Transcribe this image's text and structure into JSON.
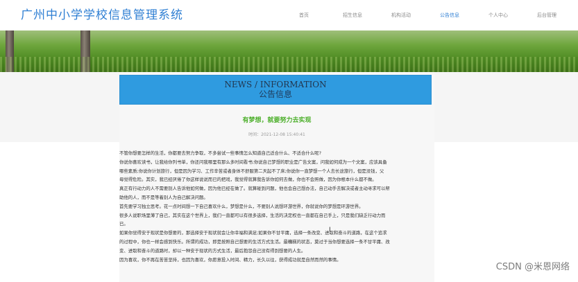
{
  "header": {
    "site_title": "广州中小学学校信息管理系统",
    "nav": [
      {
        "label": "首页"
      },
      {
        "label": "招生信息"
      },
      {
        "label": "机构活动"
      },
      {
        "label": "公告信息"
      },
      {
        "label": "个人中心"
      },
      {
        "label": "后台管理"
      }
    ],
    "active_nav": "公告信息",
    "accent_color": "#2f7fd3"
  },
  "news_box": {
    "en": "NEWS / INFORMATION",
    "cn": "公告信息",
    "bg_color": "#2f9be0"
  },
  "article": {
    "title": "有梦想，就要努力去实现",
    "time": "时间：2021-12-08 15:40:41",
    "title_color": "#4caf2a",
    "paragraphs": [
      "不管你想要怎样的生活，你都要去努力争取，不多尝试一些事情怎么知道自己适合什么、不适合什么呢?",
      "你说你喜欢读书，让我给你列书单，你还问我哪里有那么多时间看书;你说自己梦想的职业是广告文案，问我如何成为一个文案，应该具备",
      "哪些素质;你说你计划旅行，但是因为学习、工作辛苦或者身体不舒服第二天起不了床;你说你一直梦想一个人去长途旅行，但是没钱，父",
      "母觉得危险。其实，我已经厌倦了你这样说说而已的把戏，我觉得就算我告诉你如何去做，你也不会照做，因为你根本什么都不做。",
      "真正有行动力的人不需要别人告诉他如何做，因为他已经在做了。就算碰到问题，他也会自己想办法，自己动手去解决或者主动寻求可以帮",
      "助他的人，而不是等着别人为自己解决问题。",
      "首先要学习独立思考。花一点时间想一下自己喜欢什么，梦想是什么，不要别人说想环游世界，你就说你的梦想是环游世界。",
      "很多人说职场里薄了自己，其实在这个世界上，我们一直都可以有很多选择，生活的决定权也一直都在自己手上，只是我们缺乏行动力而",
      "已。",
      "如果你觉得安于现状是你想要的，那选择安于现状就会让你幸福和满足;如果你不甘平庸，选择一条改变、进取和奋斗的道路，在这个追求",
      "的过程中，你也一样会感到快乐。所谓的成功，即是按照自己想要的生活方式生活。最糟糕的状态，莫过于当你想要选择一条不甘平庸、改",
      "变、进取和奋斗的道路时，却以一种安于现状的方式生活，最后抱怨自己没有得到想要的人生。",
      "因为喜欢，你不再在苦苦坚持，也因为喜欢，你愿意投入时间、精力，长久以往，获得成功就是自然而然的事情。"
    ]
  },
  "watermark": "CSDN @米恩网络"
}
